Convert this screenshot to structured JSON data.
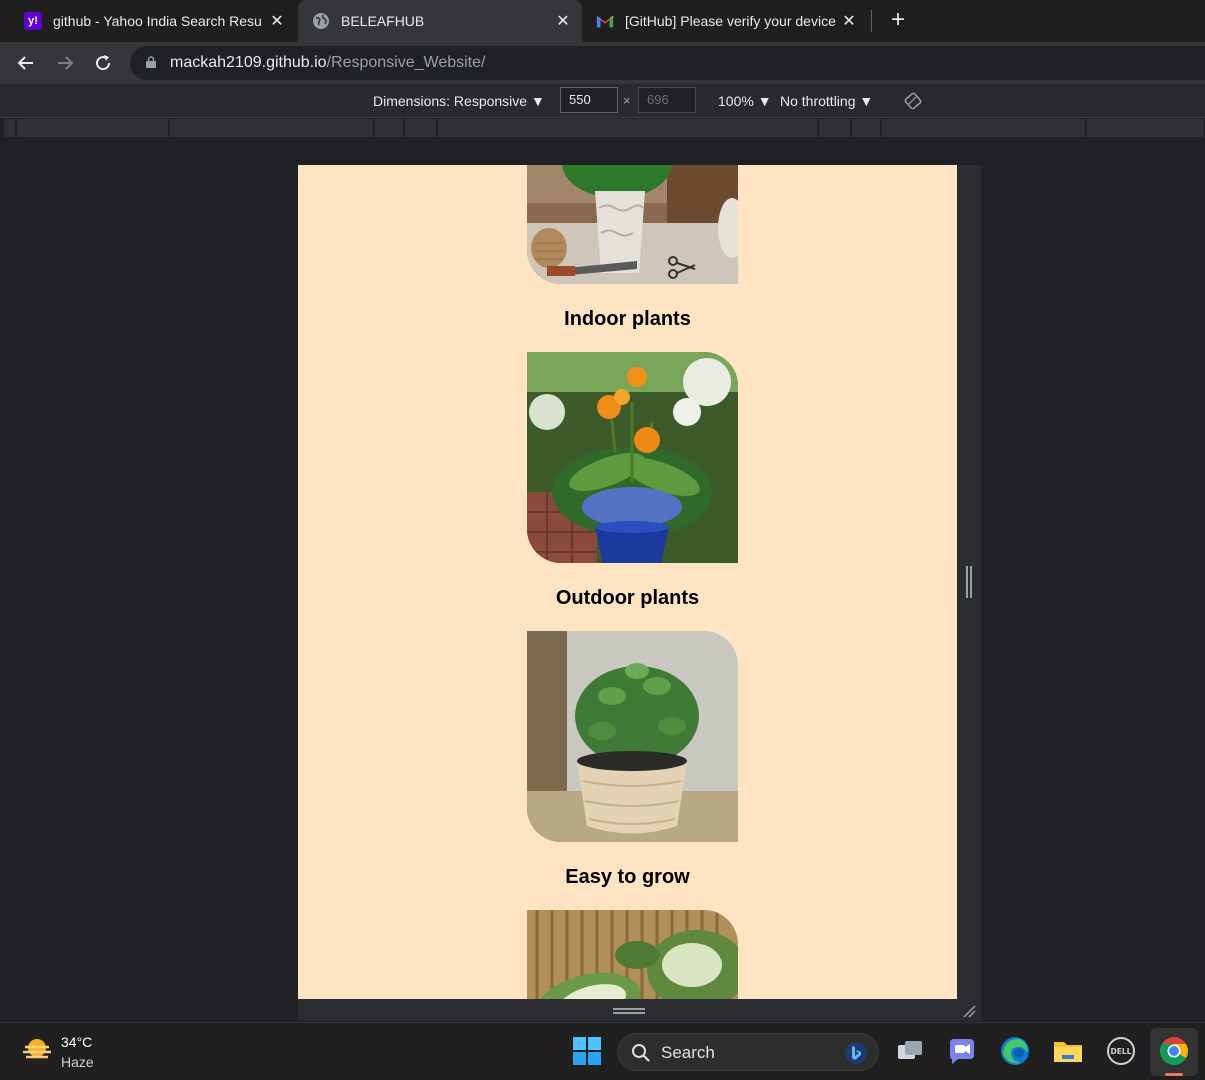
{
  "browser": {
    "tabs": [
      {
        "title": "github - Yahoo India Search Resu",
        "favicon": "yahoo-icon",
        "active": false
      },
      {
        "title": "BELEAFHUB",
        "favicon": "globe-icon",
        "active": true
      },
      {
        "title": "[GitHub] Please verify your device",
        "favicon": "gmail-icon",
        "active": false
      }
    ],
    "close_glyph": "✕",
    "new_tab_glyph": "+",
    "url_host": "mackah2109.github.io",
    "url_path": "/Responsive_Website/"
  },
  "device_toolbar": {
    "dimensions_label": "Dimensions: Responsive ▼",
    "width_value": "550",
    "height_value": "696",
    "times": "×",
    "zoom_label": "100% ▼",
    "throttle_label": "No throttling ▼"
  },
  "page": {
    "background": "#ffe4c4",
    "items": [
      {
        "caption": "Indoor plants"
      },
      {
        "caption": "Outdoor plants"
      },
      {
        "caption": "Easy to grow"
      }
    ]
  },
  "taskbar": {
    "temperature": "34°C",
    "condition": "Haze",
    "search_label": "Search"
  }
}
